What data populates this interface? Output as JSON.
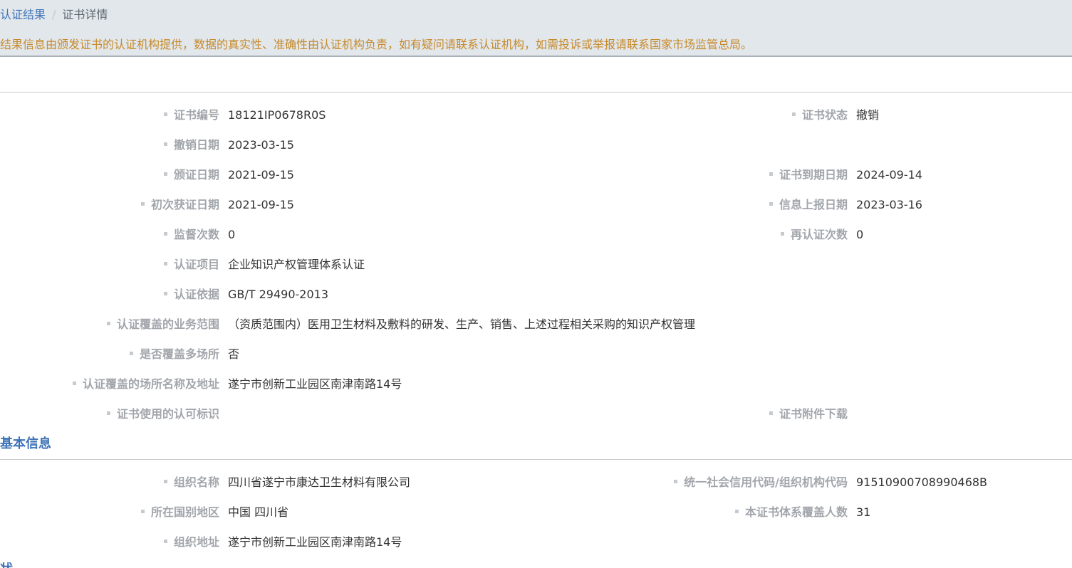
{
  "breadcrumb": {
    "link": "认证结果",
    "separator": "/",
    "current": "证书详情"
  },
  "notice": "结果信息由颁发证书的认证机构提供，数据的真实性、准确性由认证机构负责，如有疑问请联系认证机构，如需投诉或举报请联系国家市场监管总局。",
  "certificate": {
    "cert_no": {
      "label": "证书编号",
      "value": "18121IP0678R0S"
    },
    "cert_status": {
      "label": "证书状态",
      "value": "撤销"
    },
    "revoke_date": {
      "label": "撤销日期",
      "value": "2023-03-15"
    },
    "issue_date": {
      "label": "颁证日期",
      "value": "2021-09-15"
    },
    "expire_date": {
      "label": "证书到期日期",
      "value": "2024-09-14"
    },
    "first_date": {
      "label": "初次获证日期",
      "value": "2021-09-15"
    },
    "report_date": {
      "label": "信息上报日期",
      "value": "2023-03-16"
    },
    "supervise_count": {
      "label": "监督次数",
      "value": "0"
    },
    "recert_count": {
      "label": "再认证次数",
      "value": "0"
    },
    "project": {
      "label": "认证项目",
      "value": "企业知识产权管理体系认证"
    },
    "basis": {
      "label": "认证依据",
      "value": "GB/T 29490-2013"
    },
    "scope": {
      "label": "认证覆盖的业务范围",
      "value": "（资质范围内）医用卫生材料及敷料的研发、生产、销售、上述过程相关采购的知识产权管理"
    },
    "multi_site": {
      "label": "是否覆盖多场所",
      "value": "否"
    },
    "site_address": {
      "label": "认证覆盖的场所名称及地址",
      "value": "遂宁市创新工业园区南津南路14号"
    },
    "accreditation_mark": {
      "label": "证书使用的认可标识",
      "value": ""
    },
    "attachment": {
      "label": "证书附件下载",
      "value": ""
    }
  },
  "basic_info": {
    "title": "基本信息",
    "org_name": {
      "label": "组织名称",
      "value": "四川省遂宁市康达卫生材料有限公司"
    },
    "credit_code": {
      "label": "统一社会信用代码/组织机构代码",
      "value": "91510900708990468B"
    },
    "region": {
      "label": "所在国别地区",
      "value": "中国 四川省"
    },
    "headcount": {
      "label": "本证书体系覆盖人数",
      "value": "31"
    },
    "org_address": {
      "label": "组织地址",
      "value": "遂宁市创新工业园区南津南路14号"
    }
  },
  "next_section": {
    "title": "状态"
  },
  "colors": {
    "header_bg": "#e2e7ec",
    "link": "#3f73b8",
    "notice": "#c68a2a",
    "label": "#a2a6ab",
    "value": "#333333"
  }
}
